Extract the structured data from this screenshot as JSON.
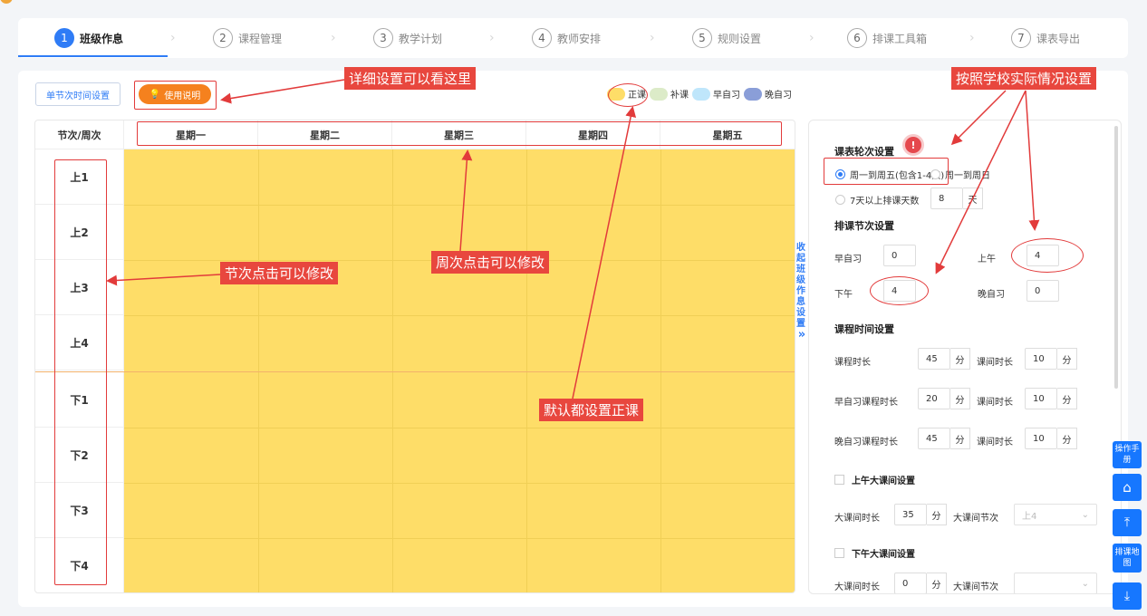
{
  "steps": [
    {
      "num": "1",
      "label": "班级作息",
      "active": true
    },
    {
      "num": "2",
      "label": "课程管理"
    },
    {
      "num": "3",
      "label": "教学计划"
    },
    {
      "num": "4",
      "label": "教师安排"
    },
    {
      "num": "5",
      "label": "规则设置"
    },
    {
      "num": "6",
      "label": "排课工具箱"
    },
    {
      "num": "7",
      "label": "课表导出"
    }
  ],
  "toolbar": {
    "single_time_label": "单节次时间设置",
    "help_label": "使用说明"
  },
  "legend": [
    {
      "label": "正课",
      "color": "#fedd68"
    },
    {
      "label": "补课",
      "color": "#dcebc8"
    },
    {
      "label": "早自习",
      "color": "#bfe6fb"
    },
    {
      "label": "晚自习",
      "color": "#8a9ed8"
    }
  ],
  "grid": {
    "corner_label": "节次/周次",
    "days": [
      "星期一",
      "星期二",
      "星期三",
      "星期四",
      "星期五"
    ],
    "periods": [
      "上1",
      "上2",
      "上3",
      "上4",
      "下1",
      "下2",
      "下3",
      "下4"
    ],
    "cell_color": "#fedd68"
  },
  "settings": {
    "collapse_label": "收起班级作息设置",
    "collapse_arrow": "»",
    "rotation": {
      "title": "课表轮次设置",
      "option_weekdays": "周一到周五(包含1-4天)",
      "option_week": "周一到周日",
      "option_custom": "7天以上排课天数",
      "custom_days_value": "8",
      "custom_days_unit": "天"
    },
    "periods": {
      "title": "排课节次设置",
      "morning_study_label": "早自习",
      "morning_study_value": "0",
      "am_label": "上午",
      "am_value": "4",
      "pm_label": "下午",
      "pm_value": "4",
      "evening_study_label": "晚自习",
      "evening_study_value": "0"
    },
    "durations": {
      "title": "课程时间设置",
      "class_length_label": "课程时长",
      "class_length_value": "45",
      "break_label": "课间时长",
      "break_value": "10",
      "morning_length_label": "早自习课程时长",
      "morning_length_value": "20",
      "morning_break_value": "10",
      "evening_length_label": "晚自习课程时长",
      "evening_length_value": "45",
      "evening_break_value": "10",
      "unit": "分"
    },
    "am_big_break": {
      "title": "上午大课间设置",
      "length_label": "大课间时长",
      "length_value": "35",
      "period_label": "大课间节次",
      "period_value": "上4"
    },
    "pm_big_break": {
      "title": "下午大课间设置",
      "length_label": "大课间时长",
      "length_value": "0",
      "period_label": "大课间节次",
      "period_value": ""
    }
  },
  "floating": {
    "manual_label": "操作手册",
    "map_label": "排课地图"
  },
  "annotations": {
    "detail_help": "详细设置可以看这里",
    "school_settings": "按照学校实际情况设置",
    "period_click": "节次点击可以修改",
    "week_click": "周次点击可以修改",
    "default_regular": "默认都设置正课"
  }
}
